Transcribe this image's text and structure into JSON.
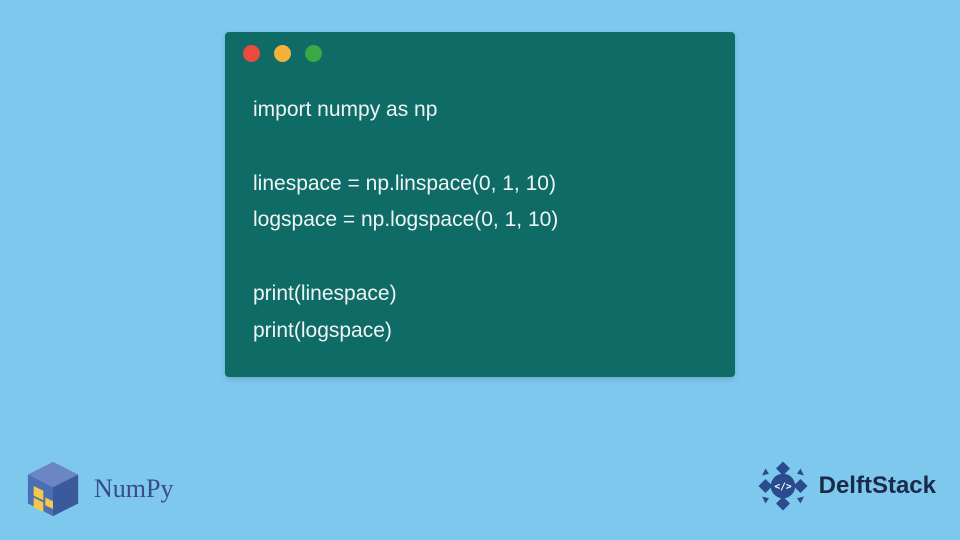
{
  "window": {
    "dots": {
      "close_semantic": "close",
      "minimize_semantic": "minimize",
      "zoom_semantic": "zoom"
    }
  },
  "code": {
    "lines": [
      "import numpy as np",
      "",
      "linespace = np.linspace(0, 1, 10)",
      "logspace = np.logspace(0, 1, 10)",
      "",
      "print(linespace)",
      "print(logspace)"
    ]
  },
  "branding": {
    "left_label": "NumPy",
    "right_label": "DelftStack"
  },
  "colors": {
    "page_bg": "#7ec8ed",
    "window_bg": "#0f6b66",
    "code_text": "#eef5f4",
    "dot_red": "#e94b3c",
    "dot_yellow": "#f2b13a",
    "dot_green": "#3aa845",
    "numpy_blue": "#4b6fb3",
    "numpy_yellow": "#f2c94c",
    "delft_primary": "#2a4b8d"
  }
}
